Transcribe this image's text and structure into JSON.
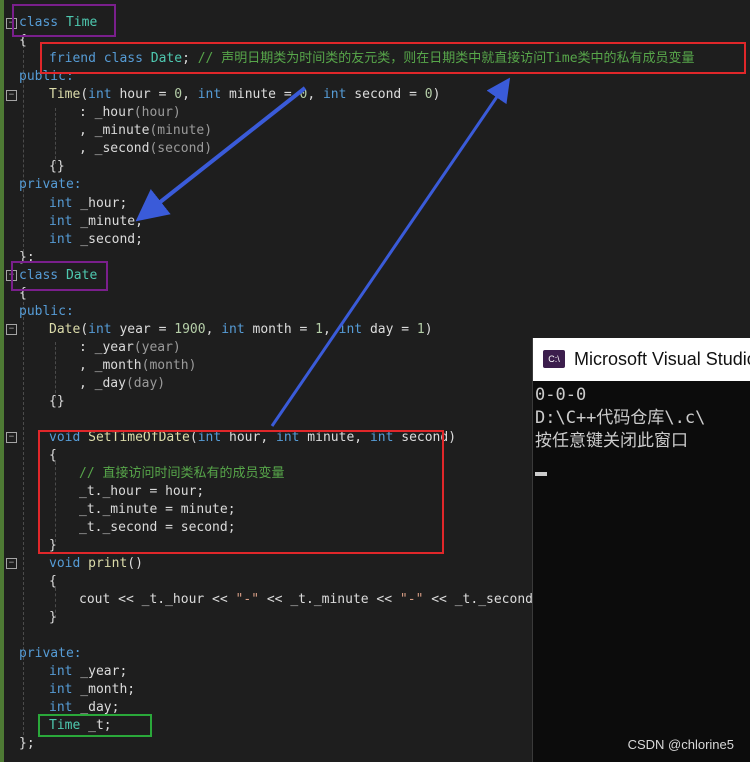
{
  "code": {
    "l1": {
      "kw": "class",
      "name": "Time"
    },
    "l2": "{",
    "l3": {
      "kw1": "friend",
      "kw2": "class",
      "name": "Date",
      "semi": ";",
      "comment": "// 声明日期类为时间类的友元类，则在日期类中就直接访问Time类中的私有成员变量"
    },
    "l4": "public:",
    "l5": {
      "fn": "Time",
      "p1": "(",
      "int1": "int",
      "rest1": " hour = ",
      "n1": "0",
      "c1": ", ",
      "int2": "int",
      "rest2": " minute = ",
      "n2": "0",
      "c2": ", ",
      "int3": "int",
      "rest3": " second = ",
      "n3": "0",
      "end": ")"
    },
    "l6": {
      "pre": ": _hour",
      "arg": "(hour)"
    },
    "l7": {
      "pre": ", _minute",
      "arg": "(minute)"
    },
    "l8": {
      "pre": ", _second",
      "arg": "(second)"
    },
    "l9": "{}",
    "l10": "private:",
    "l11": {
      "kw": "int",
      "rest": " _hour;"
    },
    "l12": {
      "kw": "int",
      "rest": " _minute;"
    },
    "l13": {
      "kw": "int",
      "rest": " _second;"
    },
    "l14": "};",
    "l15": {
      "kw": "class",
      "name": "Date"
    },
    "l16": "{",
    "l17": "public:",
    "l18": {
      "fn": "Date",
      "p1": "(",
      "int1": "int",
      "rest1": " year = ",
      "n1": "1900",
      "c1": ", ",
      "int2": "int",
      "rest2": " month = ",
      "n2": "1",
      "c2": ", ",
      "int3": "int",
      "rest3": " day = ",
      "n3": "1",
      "end": ")"
    },
    "l19": {
      "pre": ": _year",
      "arg": "(year)"
    },
    "l20": {
      "pre": ", _month",
      "arg": "(month)"
    },
    "l21": {
      "pre": ", _day",
      "arg": "(day)"
    },
    "l22": "{}",
    "l23": {
      "kw": "void",
      "fn": "SetTimeOfDate",
      "p1": "(",
      "int1": "int",
      "rest1": " hour, ",
      "int2": "int",
      "rest2": " minute, ",
      "int3": "int",
      "rest3": " second)"
    },
    "l24": "{",
    "l25": "// 直接访问时间类私有的成员变量",
    "l26": "_t._hour = hour;",
    "l27": "_t._minute = minute;",
    "l28": "_t._second = second;",
    "l29": "}",
    "l30": {
      "kw": "void",
      "fn": "print",
      "rest": "()"
    },
    "l31": "{",
    "l32": {
      "a": "cout << _t._hour << ",
      "s1": "\"-\"",
      "b": " << _t._minute << ",
      "s2": "\"-\"",
      "c": " << _t._second;"
    },
    "l33": "}",
    "l34": "private:",
    "l35": {
      "kw": "int",
      "rest": " _year;"
    },
    "l36": {
      "kw": "int",
      "rest": " _month;"
    },
    "l37": {
      "kw": "int",
      "rest": " _day;"
    },
    "l38": {
      "ty": "Time",
      "rest": " _t;"
    },
    "l39": "};"
  },
  "console": {
    "icon_text": "C:\\",
    "title": "Microsoft Visual Studio",
    "lines": [
      "0-0-0",
      "D:\\C++代码仓库\\.c\\",
      "按任意键关闭此窗口"
    ]
  },
  "watermark": "CSDN @chlorine5",
  "colors": {
    "purple_box": "#7a1f8c",
    "red_box": "#e0272a",
    "green_box": "#2aa83a",
    "arrow": "#3a5bd9"
  }
}
